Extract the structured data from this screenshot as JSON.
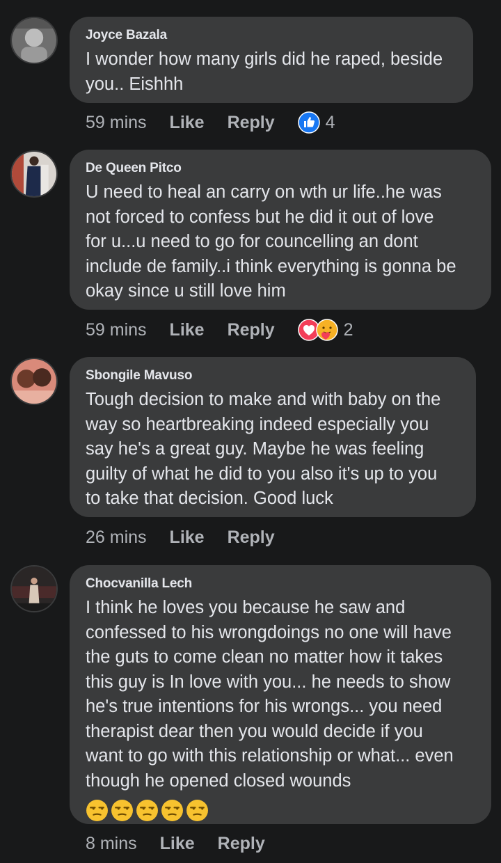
{
  "comments": [
    {
      "author": "Joyce Bazala",
      "lines": [
        "I wonder how many girls did he raped, beside",
        "you.. Eishhh"
      ],
      "time": "59 mins",
      "like": "Like",
      "reply": "Reply",
      "reactions": [
        "like-icon"
      ],
      "reaction_count": "4"
    },
    {
      "author": "De Queen Pitco",
      "lines": [
        "U need to heal an carry on wth ur life..he was",
        "not forced to confess but he did it out of love",
        "for u...u need to go for councelling an dont",
        "include de family..i think everything is gonna be",
        "okay since u still love him"
      ],
      "time": "59 mins",
      "like": "Like",
      "reply": "Reply",
      "reactions": [
        "love-icon",
        "care-icon"
      ],
      "reaction_count": "2"
    },
    {
      "author": "Sbongile Mavuso",
      "lines": [
        "Tough decision to make and with baby on the",
        "way so heartbreaking indeed especially you",
        "say he's a great guy. Maybe he was feeling",
        "guilty of what he did to you also it's up to you",
        "to take that decision. Good luck"
      ],
      "time": "26 mins",
      "like": "Like",
      "reply": "Reply"
    },
    {
      "author": "Chocvanilla Lech",
      "lines": [
        "I think he loves you because he saw and",
        "confessed to his wrongdoings no one will have",
        "the guts to come clean no matter how it takes",
        "this guy is In love with you... he needs to show",
        "he's true intentions for his wrongs... you need",
        "therapist dear then you would decide if you",
        "want to go with this relationship or what... even",
        "though he opened closed wounds"
      ],
      "emojis": [
        "unamused-face-icon",
        "unamused-face-icon",
        "unamused-face-icon",
        "unamused-face-icon",
        "unamused-face-icon"
      ],
      "time": "8 mins",
      "like": "Like",
      "reply": "Reply"
    }
  ],
  "colors": {
    "background": "#18191a",
    "bubble": "#3a3b3c",
    "primary_text": "#e4e6eb",
    "secondary_text": "#b0b3b8",
    "like_blue": "#1877f2",
    "love_red": "#f33e58"
  }
}
